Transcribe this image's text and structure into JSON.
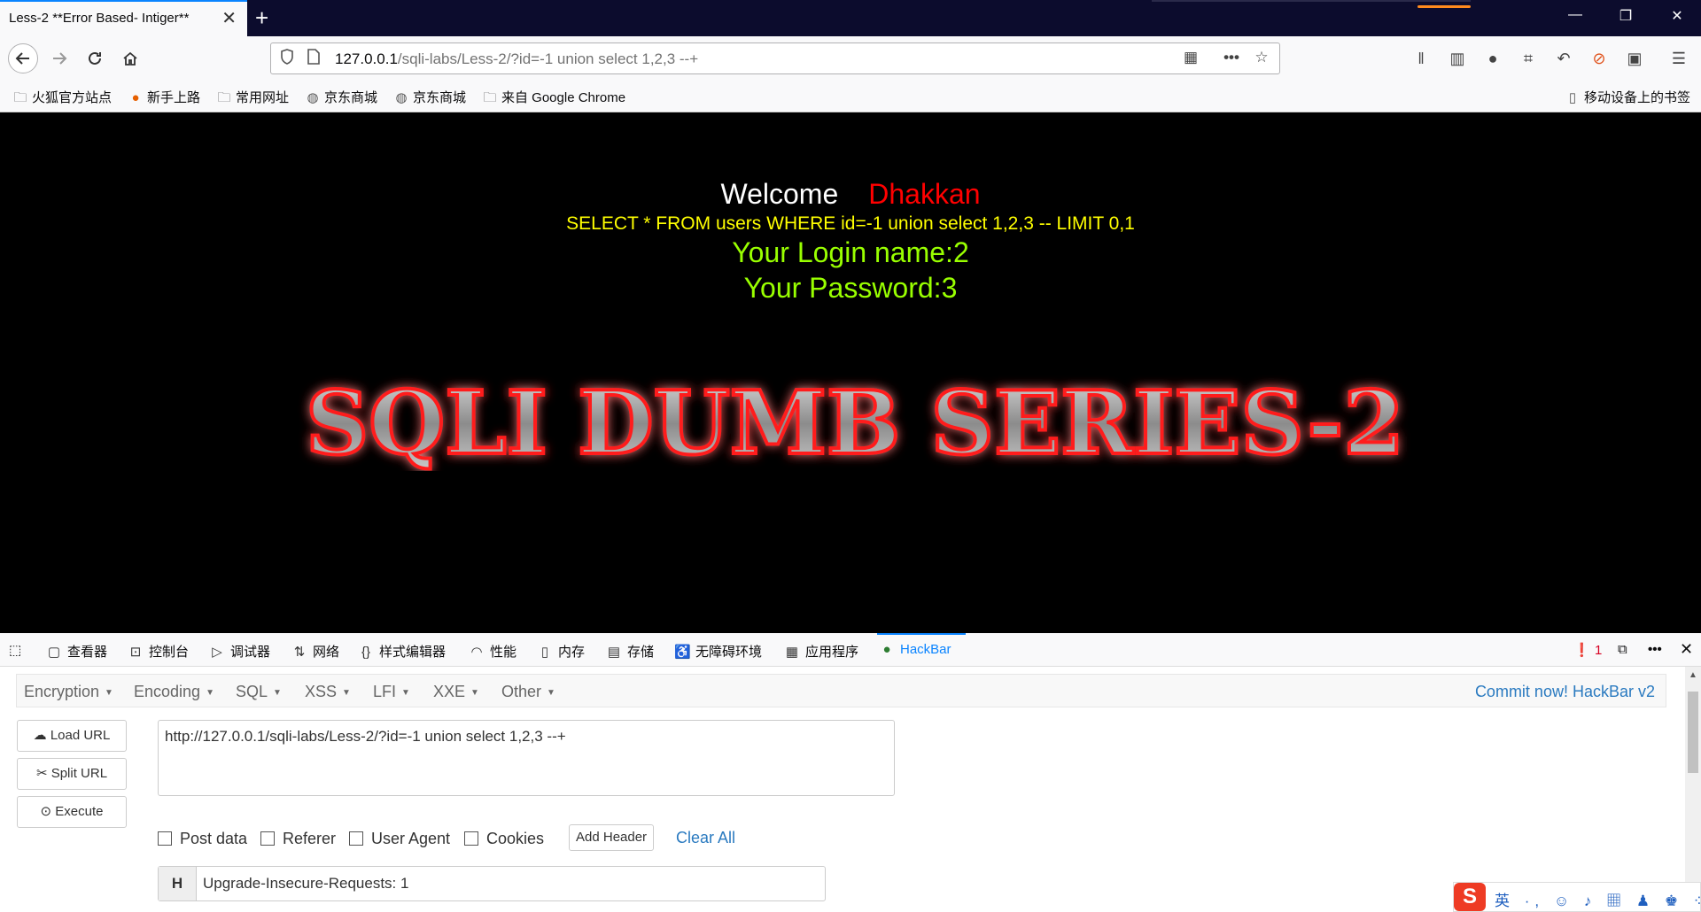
{
  "browser": {
    "tab_title": "Less-2 **Error Based- Intiger**",
    "tab_close": "✕",
    "new_tab": "+",
    "url_host": "127.0.0.1",
    "url_rest": "/sqli-labs/Less-2/?id=-1 union select 1,2,3 --+",
    "window_controls": [
      "—",
      "❐",
      "✕"
    ]
  },
  "bookmarks": [
    {
      "icon": "folder-icon",
      "label": "火狐官方站点"
    },
    {
      "icon": "firefox-icon",
      "label": "新手上路"
    },
    {
      "icon": "folder-icon",
      "label": "常用网址"
    },
    {
      "icon": "globe-icon",
      "label": "京东商城"
    },
    {
      "icon": "globe-icon",
      "label": "京东商城"
    },
    {
      "icon": "folder-icon",
      "label": "来自 Google Chrome"
    }
  ],
  "bookmarks_mobile": "移动设备上的书签",
  "page": {
    "welcome": "Welcome",
    "user": "Dhakkan",
    "query": "SELECT * FROM users WHERE id=-1 union select 1,2,3 -- LIMIT 0,1",
    "login_name": "Your Login name:2",
    "password": "Your Password:3",
    "banner_text": "SQLI DUMB SERIES-2"
  },
  "devtools": {
    "tabs": [
      "查看器",
      "控制台",
      "调试器",
      "网络",
      "样式编辑器",
      "性能",
      "内存",
      "存储",
      "无障碍环境",
      "应用程序",
      "HackBar"
    ],
    "error_count": "1"
  },
  "hackbar": {
    "menu": [
      "Encryption",
      "Encoding",
      "SQL",
      "XSS",
      "LFI",
      "XXE",
      "Other"
    ],
    "commit": "Commit now! HackBar v2",
    "buttons": {
      "load": "Load URL",
      "split": "Split URL",
      "execute": "Execute"
    },
    "url_value": "http://127.0.0.1/sqli-labs/Less-2/?id=-1 union select 1,2,3 --+",
    "checks": [
      "Post data",
      "Referer",
      "User Agent",
      "Cookies"
    ],
    "add_header": "Add Header",
    "clear_all": "Clear All",
    "header_prefix": "H",
    "header_value": "Upgrade-Insecure-Requests: 1"
  },
  "ime": {
    "logo": "S",
    "text": "英 ·, ☺ ♪ ▦ ♟ ♚ ⁘"
  },
  "colors": {
    "accent": "#0a84ff",
    "yellow": "#ffff00",
    "green": "#99ff00",
    "red": "#ff0000"
  }
}
